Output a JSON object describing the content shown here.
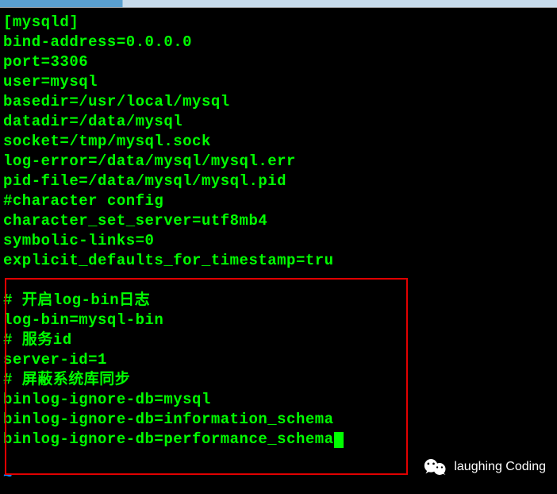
{
  "terminal": {
    "lines": [
      "[mysqld]",
      "bind-address=0.0.0.0",
      "port=3306",
      "user=mysql",
      "basedir=/usr/local/mysql",
      "datadir=/data/mysql",
      "socket=/tmp/mysql.sock",
      "log-error=/data/mysql/mysql.err",
      "pid-file=/data/mysql/mysql.pid",
      "#character config",
      "character_set_server=utf8mb4",
      "symbolic-links=0",
      "explicit_defaults_for_timestamp=tru"
    ],
    "boxed_lines": [
      "# 开启log-bin日志",
      "log-bin=mysql-bin",
      "# 服务id",
      "server-id=1",
      "# 屏蔽系统库同步",
      "binlog-ignore-db=mysql",
      "binlog-ignore-db=information_schema",
      "binlog-ignore-db=performance_schema"
    ],
    "tilde": "~"
  },
  "watermark": {
    "text": "laughing Coding"
  }
}
